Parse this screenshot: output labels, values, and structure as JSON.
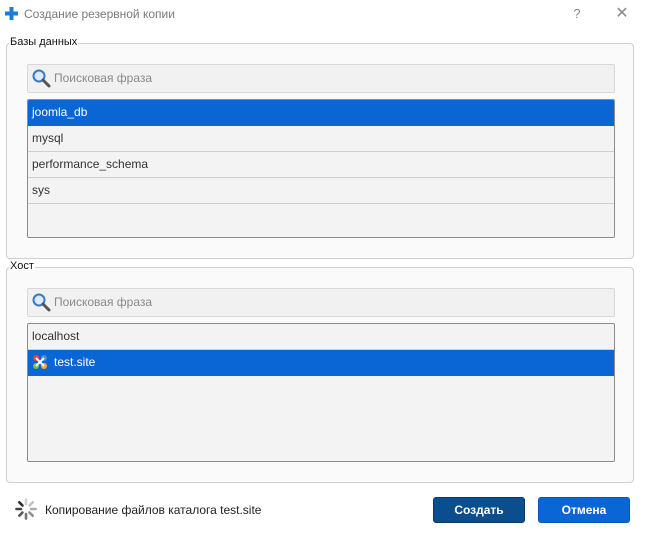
{
  "window": {
    "title": "Создание резервной копии",
    "help_label": "?",
    "close_label": "✕"
  },
  "databases": {
    "legend": "Базы данных",
    "search_placeholder": "Поисковая фраза",
    "items": [
      {
        "label": "joomla_db",
        "selected": true
      },
      {
        "label": "mysql",
        "selected": false
      },
      {
        "label": "performance_schema",
        "selected": false
      },
      {
        "label": "sys",
        "selected": false
      }
    ]
  },
  "hosts": {
    "legend": "Хост",
    "search_placeholder": "Поисковая фраза",
    "items": [
      {
        "label": "localhost",
        "selected": false
      },
      {
        "label": "test.site",
        "selected": true,
        "icon": "joomla-icon"
      }
    ]
  },
  "status": {
    "icon": "spinner-icon",
    "text": "Копирование файлов каталога  test.site"
  },
  "buttons": {
    "create_label": "Создать",
    "cancel_label": "Отмена"
  },
  "colors": {
    "selection": "#0a66d4",
    "create_button": "#0b4e8e",
    "cancel_button": "#0a66d4",
    "title_icon": "#1a7fd6"
  }
}
